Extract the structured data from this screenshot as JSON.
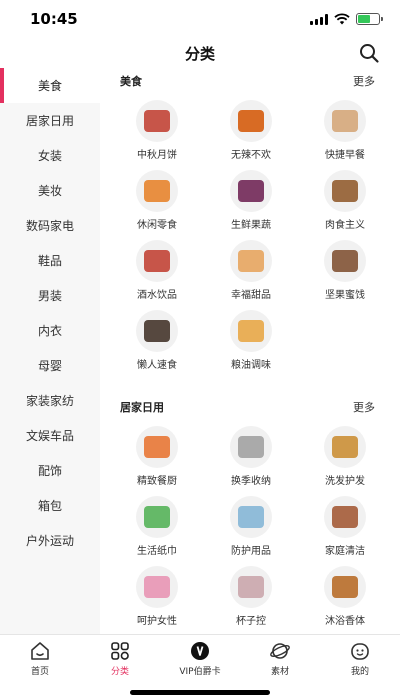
{
  "status_bar": {
    "time": "10:45",
    "battery_level": 0.6
  },
  "header": {
    "title": "分类"
  },
  "sidebar": {
    "items": [
      {
        "label": "美食"
      },
      {
        "label": "居家日用"
      },
      {
        "label": "女装"
      },
      {
        "label": "美妆"
      },
      {
        "label": "数码家电"
      },
      {
        "label": "鞋品"
      },
      {
        "label": "男装"
      },
      {
        "label": "内衣"
      },
      {
        "label": "母婴"
      },
      {
        "label": "家装家纺"
      },
      {
        "label": "文娱车品"
      },
      {
        "label": "配饰"
      },
      {
        "label": "箱包"
      },
      {
        "label": "户外运动"
      }
    ]
  },
  "sections": [
    {
      "title": "美食",
      "more": "更多",
      "items": [
        {
          "label": "中秋月饼",
          "color": "#c0392b"
        },
        {
          "label": "无辣不欢",
          "color": "#d35400"
        },
        {
          "label": "快捷早餐",
          "color": "#d4a373"
        },
        {
          "label": "休闲零食",
          "color": "#e67e22"
        },
        {
          "label": "生鲜果蔬",
          "color": "#6a1b4d"
        },
        {
          "label": "肉食主义",
          "color": "#8d5524"
        },
        {
          "label": "酒水饮品",
          "color": "#c0392b"
        },
        {
          "label": "幸福甜品",
          "color": "#e6a157"
        },
        {
          "label": "坚果蜜饯",
          "color": "#7b4a2a"
        },
        {
          "label": "懒人速食",
          "color": "#3b2a20"
        },
        {
          "label": "粮油调味",
          "color": "#e8a33d"
        }
      ]
    },
    {
      "title": "居家日用",
      "more": "更多",
      "items": [
        {
          "label": "精致餐厨",
          "color": "#e8702a"
        },
        {
          "label": "换季收纳",
          "color": "#9e9e9e"
        },
        {
          "label": "洗发护发",
          "color": "#c98a2b"
        },
        {
          "label": "生活纸巾",
          "color": "#4caf50"
        },
        {
          "label": "防护用品",
          "color": "#7fb3d5"
        },
        {
          "label": "家庭清洁",
          "color": "#a0522d"
        },
        {
          "label": "呵护女性",
          "color": "#e88fb0"
        },
        {
          "label": "杯子控",
          "color": "#c8a2a8"
        },
        {
          "label": "沐浴香体",
          "color": "#b5651d"
        },
        {
          "label": "",
          "color": "#e8702a"
        },
        {
          "label": "",
          "color": "#9e9e9e"
        },
        {
          "label": "",
          "color": "#4caf50"
        }
      ]
    }
  ],
  "tabs": [
    {
      "label": "首页",
      "icon": "home-icon"
    },
    {
      "label": "分类",
      "icon": "category-icon"
    },
    {
      "label": "VIP伯爵卡",
      "icon": "vip-card-icon"
    },
    {
      "label": "素材",
      "icon": "material-icon"
    },
    {
      "label": "我的",
      "icon": "profile-icon"
    }
  ],
  "colors": {
    "accent": "#e3305f",
    "sidebar_bg": "#f7f7f7"
  }
}
